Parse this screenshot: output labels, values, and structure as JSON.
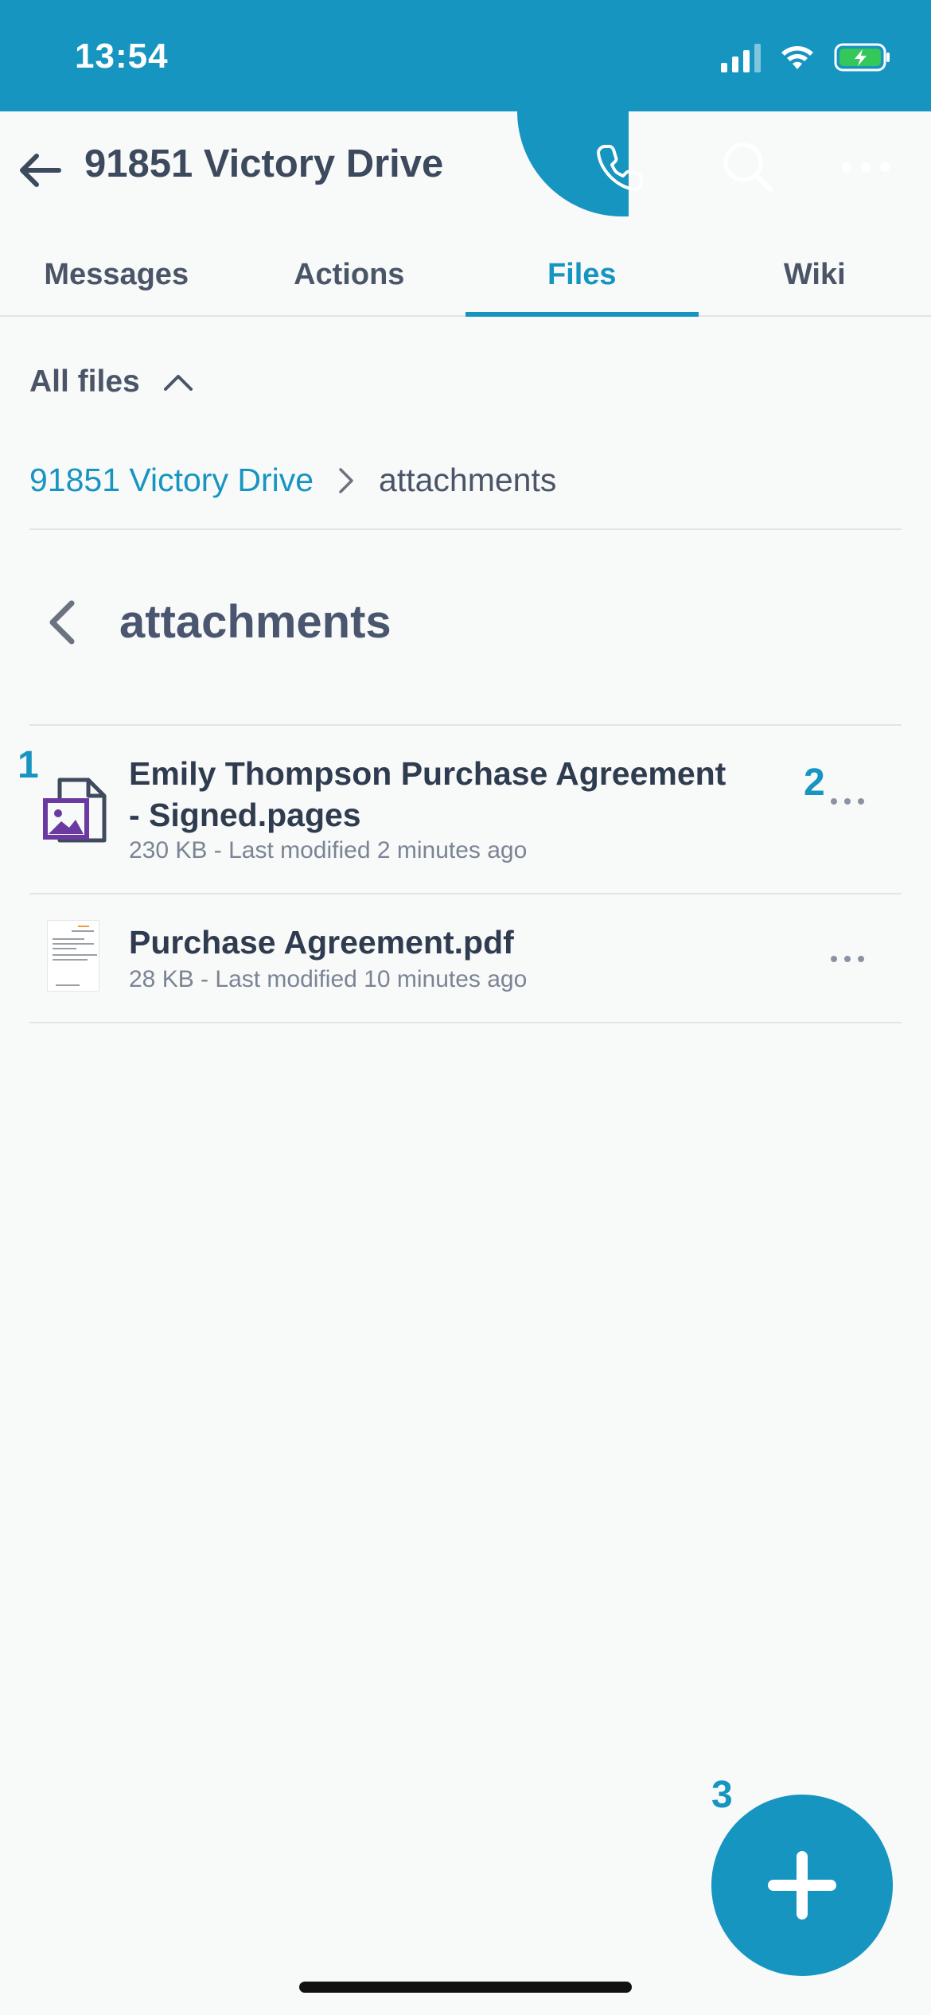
{
  "status_bar": {
    "time": "13:54"
  },
  "header": {
    "title": "91851 Victory Drive"
  },
  "tabs": [
    {
      "label": "Messages",
      "active": false
    },
    {
      "label": "Actions",
      "active": false
    },
    {
      "label": "Files",
      "active": true
    },
    {
      "label": "Wiki",
      "active": false
    }
  ],
  "filter": {
    "label": "All files"
  },
  "breadcrumb": {
    "parent": "91851 Victory Drive",
    "current": "attachments"
  },
  "folder": {
    "title": "attachments"
  },
  "files": [
    {
      "name_line1": "Emily Thompson Purchase Agreement",
      "name_line2": "- Signed.pages",
      "meta": "230 KB - Last modified 2 minutes ago",
      "icon": "pages-document-icon"
    },
    {
      "name_line1": "Purchase Agreement.pdf",
      "meta": "28 KB - Last modified 10 minutes ago",
      "icon": "pdf-thumbnail"
    }
  ],
  "markers": {
    "m1": "1",
    "m2": "2",
    "m3": "3"
  },
  "colors": {
    "accent": "#1795c1",
    "text": "#3d4a5e",
    "background": "#f8f9f9",
    "pages_icon": "#6b3aa0"
  }
}
